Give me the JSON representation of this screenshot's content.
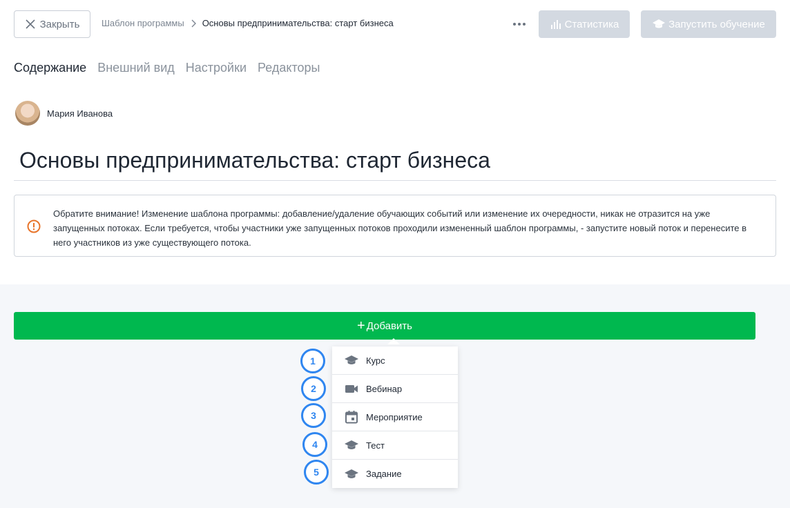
{
  "header": {
    "close_label": "Закрыть",
    "breadcrumb": [
      "Шаблон программы",
      "Основы предпринимательства: старт бизнеса"
    ],
    "stat_label": "Статистика",
    "run_label": "Запустить обучение"
  },
  "tabs": [
    {
      "label": "Содержание",
      "active": true
    },
    {
      "label": "Внешний вид",
      "active": false
    },
    {
      "label": "Настройки",
      "active": false
    },
    {
      "label": "Редакторы",
      "active": false
    }
  ],
  "author": {
    "name": "Мария Иванова"
  },
  "page_title": "Основы предпринимательства: старт бизнеса",
  "notice": {
    "text": "Обратите внимание! Изменение шаблона программы: добавление/удаление обучающих событий или изменение их очередности, никак не отразится на уже запущенных потоках. Если требуется, чтобы участники уже запущенных потоков проходили измененный шаблон программы, - запустите новый поток и перенесите в него участников из уже существующего потока."
  },
  "add_button": {
    "label": "Добавить"
  },
  "menu": [
    {
      "label": "Курс",
      "icon": "graduation-cap-icon",
      "marker": "1"
    },
    {
      "label": "Вебинар",
      "icon": "video-camera-icon",
      "marker": "2"
    },
    {
      "label": "Мероприятие",
      "icon": "calendar-icon",
      "marker": "3"
    },
    {
      "label": "Тест",
      "icon": "graduation-cap-icon",
      "marker": "4"
    },
    {
      "label": "Задание",
      "icon": "graduation-cap-icon",
      "marker": "5"
    }
  ],
  "colors": {
    "accent_green": "#00b84f",
    "disabled_button": "#d3d9e1",
    "warning_orange": "#e8742a",
    "marker_blue": "#2f86f0"
  }
}
